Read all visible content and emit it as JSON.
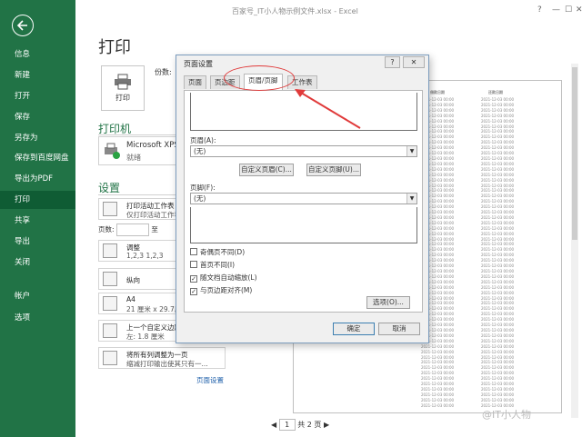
{
  "window": {
    "title": "百家号_IT小人物示例文件.xlsx - Excel",
    "controls": [
      "?",
      "—",
      "☐",
      "✕"
    ]
  },
  "sidebar": {
    "items": [
      "信息",
      "新建",
      "打开",
      "保存",
      "另存为",
      "保存到百度网盘",
      "导出为PDF",
      "打印",
      "共享",
      "导出",
      "关闭",
      "帐户",
      "选项"
    ],
    "active": "打印"
  },
  "print_panel": {
    "title": "打印",
    "print_button": "打印",
    "copies_label": "份数:",
    "printer_section": "打印机",
    "printer_name": "Microsoft XPS",
    "printer_status": "就绪",
    "settings_section": "设置",
    "settings": [
      {
        "l1": "打印活动工作表",
        "l2": "仅打印活动工作表"
      },
      {
        "l1": "调整",
        "l2": "1,2,3    1,2,3"
      },
      {
        "l1": "纵向",
        "l2": ""
      },
      {
        "l1": "A4",
        "l2": "21 厘米 x 29.7厘米"
      },
      {
        "l1": "上一个自定义边距设置",
        "l2": "左: 1.8 厘米"
      },
      {
        "l1": "将所有列调整为一页",
        "l2": "缩减打印输出使其只有一..."
      }
    ],
    "pages_label": "页数:",
    "pages_to": "至",
    "page_setup_link": "页面设置"
  },
  "pager": {
    "current": "1",
    "total": "共 2 页"
  },
  "watermark": "@IT小人物",
  "dialog": {
    "title": "页面设置",
    "help": "?",
    "close": "✕",
    "tabs": [
      "页面",
      "页边距",
      "页眉/页脚",
      "工作表"
    ],
    "active_tab": "页眉/页脚",
    "header_label": "页眉(A):",
    "header_value": "(无)",
    "custom_header": "自定义页眉(C)...",
    "custom_footer": "自定义页脚(U)...",
    "footer_label": "页脚(F):",
    "footer_value": "(无)",
    "checkboxes": [
      {
        "label": "奇偶页不同(D)",
        "checked": false
      },
      {
        "label": "首页不同(I)",
        "checked": false
      },
      {
        "label": "随文档自动缩放(L)",
        "checked": true
      },
      {
        "label": "与页边距对齐(M)",
        "checked": true
      }
    ],
    "options_button": "选项(O)...",
    "ok_button": "确定",
    "cancel_button": "取消"
  },
  "preview_table": {
    "headers": [
      "借款日期",
      "还款日期"
    ],
    "row_text": "2021-12-03 00:00"
  },
  "colors": {
    "accent": "#217346",
    "annotation": "#e03a3a"
  }
}
